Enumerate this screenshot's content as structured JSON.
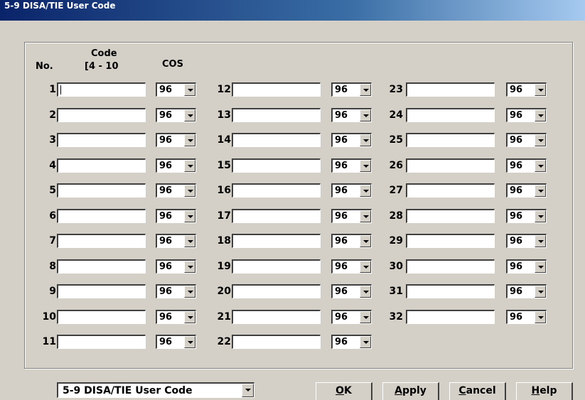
{
  "window": {
    "title": "5-9 DISA/TIE User Code"
  },
  "headers": {
    "no": "No.",
    "code": "Code",
    "code_range": "[4 - 10",
    "cos": "COS"
  },
  "rows": [
    {
      "no": "1",
      "cos": "96"
    },
    {
      "no": "2",
      "cos": "96"
    },
    {
      "no": "3",
      "cos": "96"
    },
    {
      "no": "4",
      "cos": "96"
    },
    {
      "no": "5",
      "cos": "96"
    },
    {
      "no": "6",
      "cos": "96"
    },
    {
      "no": "7",
      "cos": "96"
    },
    {
      "no": "8",
      "cos": "96"
    },
    {
      "no": "9",
      "cos": "96"
    },
    {
      "no": "10",
      "cos": "96"
    },
    {
      "no": "11",
      "cos": "96"
    },
    {
      "no": "12",
      "cos": "96"
    },
    {
      "no": "13",
      "cos": "96"
    },
    {
      "no": "14",
      "cos": "96"
    },
    {
      "no": "15",
      "cos": "96"
    },
    {
      "no": "16",
      "cos": "96"
    },
    {
      "no": "17",
      "cos": "96"
    },
    {
      "no": "18",
      "cos": "96"
    },
    {
      "no": "19",
      "cos": "96"
    },
    {
      "no": "20",
      "cos": "96"
    },
    {
      "no": "21",
      "cos": "96"
    },
    {
      "no": "22",
      "cos": "96"
    },
    {
      "no": "23",
      "cos": "96"
    },
    {
      "no": "24",
      "cos": "96"
    },
    {
      "no": "25",
      "cos": "96"
    },
    {
      "no": "26",
      "cos": "96"
    },
    {
      "no": "27",
      "cos": "96"
    },
    {
      "no": "28",
      "cos": "96"
    },
    {
      "no": "29",
      "cos": "96"
    },
    {
      "no": "30",
      "cos": "96"
    },
    {
      "no": "31",
      "cos": "96"
    },
    {
      "no": "32",
      "cos": "96"
    }
  ],
  "footer": {
    "page_select": "5-9 DISA/TIE User Code",
    "ok": {
      "mnemonic": "O",
      "rest": "K"
    },
    "apply": {
      "mnemonic": "A",
      "rest": "pply"
    },
    "cancel": {
      "mnemonic": "C",
      "rest": "ancel"
    },
    "help": {
      "mnemonic": "H",
      "rest": "elp"
    }
  },
  "colors": {
    "dialog_bg": "#d4d0c8",
    "titlebar": "#0a246a",
    "field_bg": "#ffffff"
  }
}
